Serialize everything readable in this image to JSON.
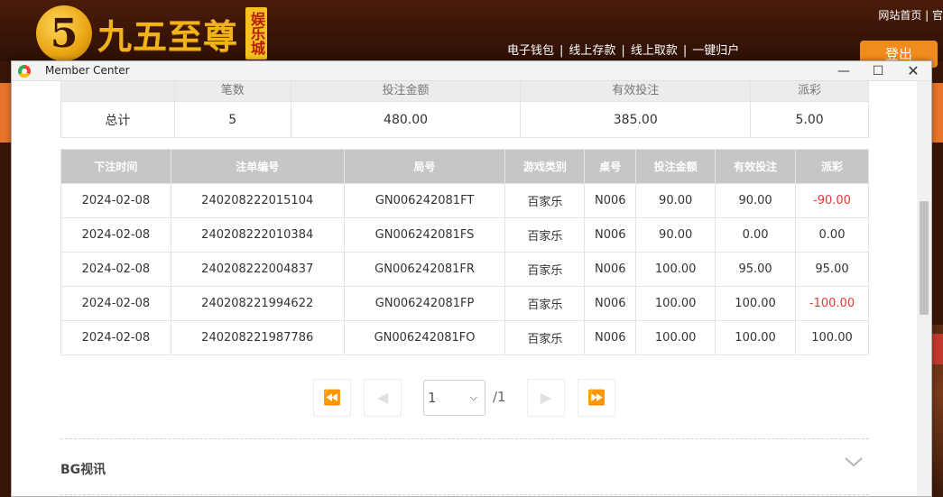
{
  "site": {
    "logo_digit": "5",
    "logo_text": "九五至尊",
    "logo_sub": "娱乐城",
    "top_links": "网站首页 | 官",
    "nav": [
      "电子钱包",
      "线上存款",
      "线上取款",
      "一键归户"
    ],
    "logout": "登出"
  },
  "window": {
    "title": "Member Center"
  },
  "summary": {
    "headers": [
      "",
      "笔数",
      "投注金额",
      "有效投注",
      "派彩"
    ],
    "row": [
      "总计",
      "5",
      "480.00",
      "385.00",
      "5.00"
    ]
  },
  "bets": {
    "headers": [
      "下注时间",
      "注单编号",
      "局号",
      "游戏类别",
      "桌号",
      "投注金额",
      "有效投注",
      "派彩"
    ],
    "rows": [
      [
        "2024-02-08",
        "240208222015104",
        "GN006242081FT",
        "百家乐",
        "N006",
        "90.00",
        "90.00",
        "-90.00"
      ],
      [
        "2024-02-08",
        "240208222010384",
        "GN006242081FS",
        "百家乐",
        "N006",
        "90.00",
        "0.00",
        "0.00"
      ],
      [
        "2024-02-08",
        "240208222004837",
        "GN006242081FR",
        "百家乐",
        "N006",
        "100.00",
        "95.00",
        "95.00"
      ],
      [
        "2024-02-08",
        "240208221994622",
        "GN006242081FP",
        "百家乐",
        "N006",
        "100.00",
        "100.00",
        "-100.00"
      ],
      [
        "2024-02-08",
        "240208221987786",
        "GN006242081FO",
        "百家乐",
        "N006",
        "100.00",
        "100.00",
        "100.00"
      ]
    ]
  },
  "pagination": {
    "current": "1",
    "total": "/1"
  },
  "section": {
    "title": "BG视讯"
  },
  "colors": {
    "negative": "#e53935",
    "header_bg": "#c6c6c6",
    "accent_orange": "#f08c1e"
  }
}
